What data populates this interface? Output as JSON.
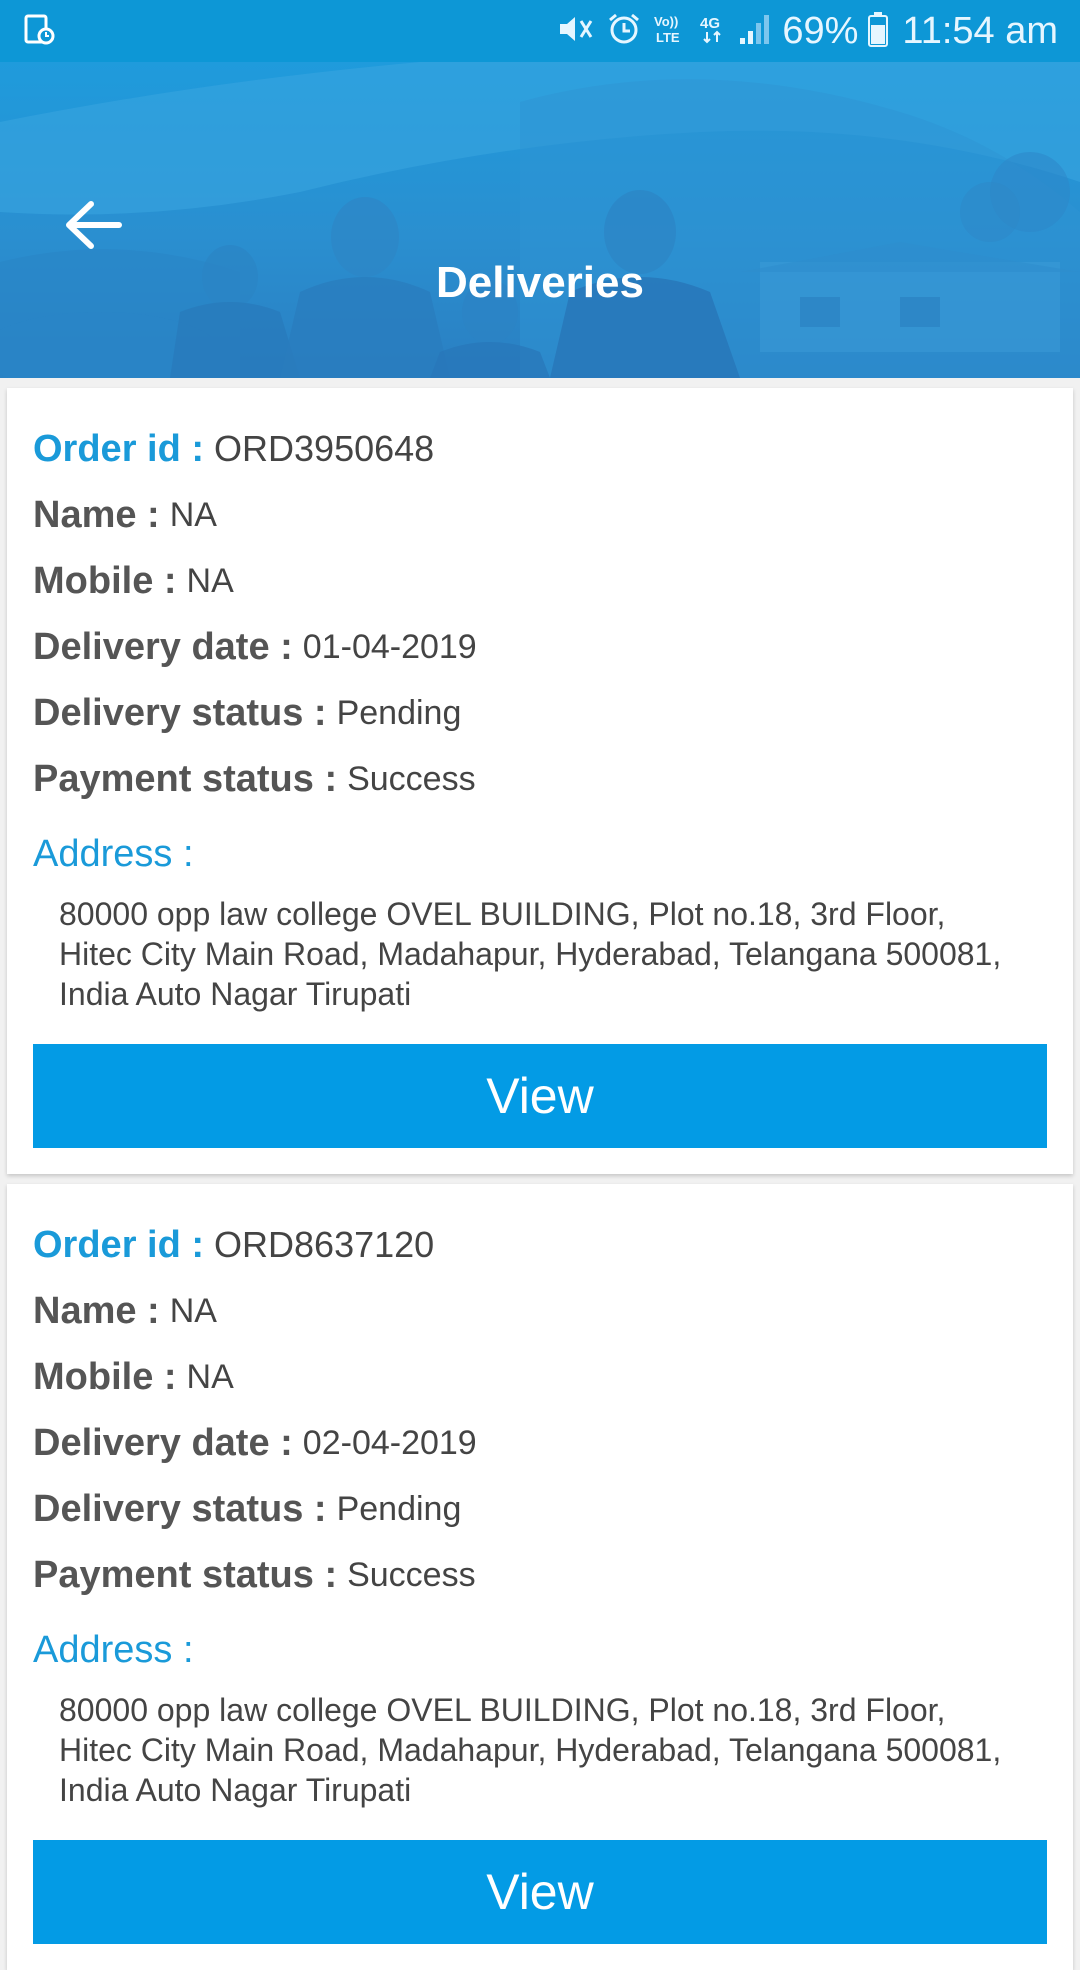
{
  "status_bar": {
    "battery": "69%",
    "time": "11:54 am",
    "icons": [
      "screenshot-icon",
      "mute-icon",
      "alarm-icon",
      "volte-icon",
      "4g-icon",
      "signal-icon",
      "battery-icon"
    ]
  },
  "header": {
    "title": "Deliveries",
    "back_icon": "arrow-left-icon"
  },
  "labels": {
    "order_id": "Order id :",
    "name": "Name :",
    "mobile": "Mobile :",
    "delivery_date": "Delivery date :",
    "delivery_status": "Delivery status :",
    "payment_status": "Payment status :",
    "address": "Address :"
  },
  "deliveries": [
    {
      "order_id": "ORD3950648",
      "name": "NA",
      "mobile": "NA",
      "delivery_date": "01-04-2019",
      "delivery_status": "Pending",
      "payment_status": "Success",
      "address": "80000 opp law college OVEL BUILDING, Plot no.18, 3rd Floor, Hitec City Main Road, Madahapur, Hyderabad, Telangana 500081, India Auto Nagar Tirupati",
      "button_label": "View"
    },
    {
      "order_id": "ORD8637120",
      "name": "NA",
      "mobile": "NA",
      "delivery_date": "02-04-2019",
      "delivery_status": "Pending",
      "payment_status": "Success",
      "address": "80000 opp law college OVEL BUILDING, Plot no.18, 3rd Floor, Hitec City Main Road, Madahapur, Hyderabad, Telangana 500081, India Auto Nagar Tirupati",
      "button_label": "View"
    }
  ],
  "colors": {
    "primary": "#039be5",
    "status_bar": "#0d97d6",
    "accent_text": "#1a9ad9"
  }
}
